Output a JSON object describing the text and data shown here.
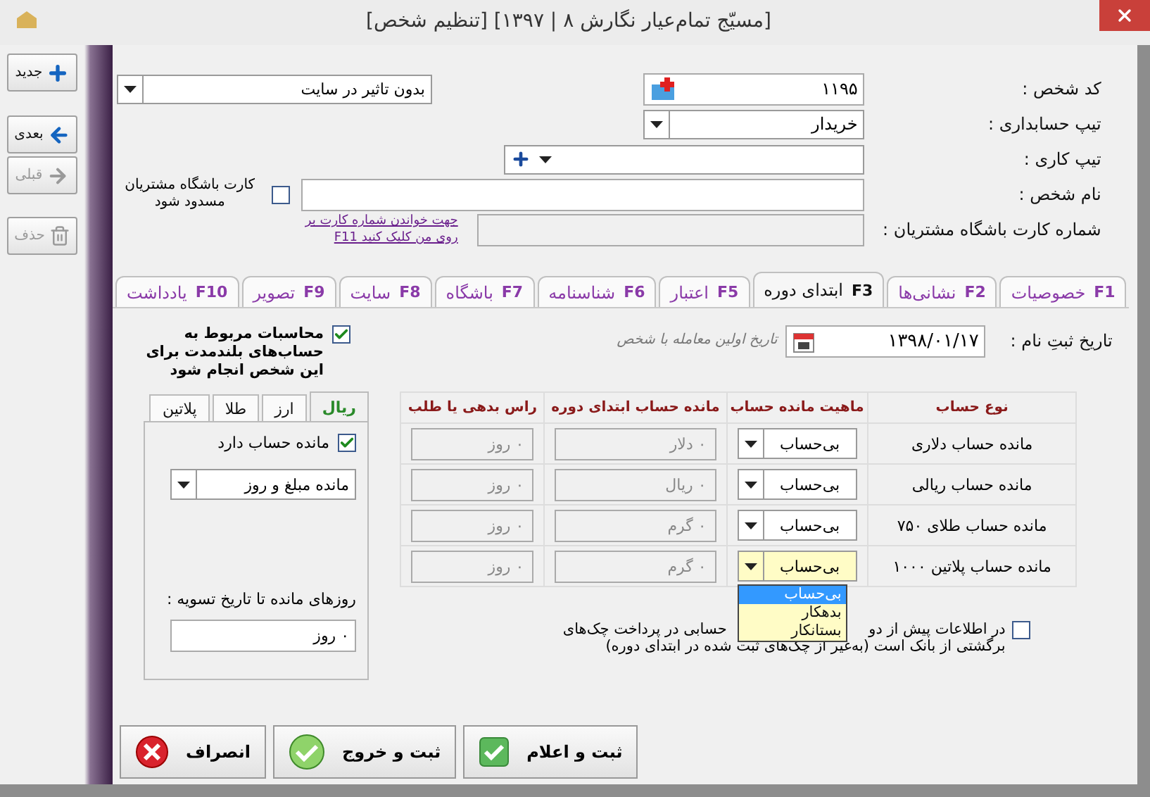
{
  "window": {
    "title": "[مسیّج تمام‌عیار نگارش ۸ | ۱۳۹۷] [تنظیم شخص]"
  },
  "sidebar": {
    "buttons": [
      {
        "label": "جدید",
        "kind": "new",
        "disabled": false
      },
      {
        "label": "بعدی",
        "kind": "next",
        "disabled": false
      },
      {
        "label": "قبلی",
        "kind": "prev",
        "disabled": true
      },
      {
        "label": "حذف",
        "kind": "delete",
        "disabled": true
      }
    ]
  },
  "header": {
    "person_code": {
      "label": "کد شخص :",
      "value": "۱۱۹۵"
    },
    "accounting_type": {
      "label": "تیپ حسابداری :",
      "value": "خریدار"
    },
    "job_type": {
      "label": "تیپ کاری :"
    },
    "person_name": {
      "label": "نام شخص :"
    },
    "club_card": {
      "label": "شماره کارت باشگاه مشتریان :"
    },
    "site_effect": {
      "value": "بدون تاثیر در سایت"
    },
    "block_card": {
      "label": "کارت باشگاه مشتریان مسدود شود",
      "checked": false
    },
    "card_link": "جهت خواندن شماره کارت بر روی من کلیک کنید F11"
  },
  "tabs": [
    {
      "label": "خصوصیات",
      "key": "F1",
      "selected": false
    },
    {
      "label": "نشانی‌ها",
      "key": "F2",
      "selected": false
    },
    {
      "label": "ابتدای دوره",
      "key": "F3",
      "selected": true
    },
    {
      "label": "اعتبار",
      "key": "F5",
      "selected": false
    },
    {
      "label": "شناسنامه",
      "key": "F6",
      "selected": false
    },
    {
      "label": "باشگاه",
      "key": "F7",
      "selected": false
    },
    {
      "label": "سایت",
      "key": "F8",
      "selected": false
    },
    {
      "label": "تصویر",
      "key": "F9",
      "selected": false
    },
    {
      "label": "یادداشت",
      "key": "F10",
      "selected": false
    }
  ],
  "opening": {
    "registration_date": {
      "label": "تاریخ ثبتِ نام :",
      "value": "۱۳۹۸/۰۱/۱۷",
      "hint": "تاریخ اولین معامله با شخص"
    },
    "long_term": {
      "label": "محاسبات مربوط به حساب‌های بلندمدت برای این شخص انجام شود",
      "checked": true
    },
    "currency_tabs": [
      {
        "label": "ریال",
        "selected": true
      },
      {
        "label": "ارز",
        "selected": false
      },
      {
        "label": "طلا",
        "selected": false
      },
      {
        "label": "پلاتین",
        "selected": false
      }
    ],
    "has_balance": {
      "label": "مانده حساب دارد",
      "checked": true
    },
    "balance_mode": "مانده مبلغ و روز",
    "days_label": "روزهای مانده تا تاریخ تسویه :",
    "days_value": "٠ روز",
    "table": {
      "columns": [
        "نوع حساب",
        "ماهیت مانده حساب",
        "مانده حساب ابتدای دوره",
        "راس بدهی یا طلب"
      ],
      "rows": [
        {
          "type": "مانده حساب دلاری",
          "nature": "بی‌حساب",
          "amount": "٠ دلار",
          "due": "٠ روز",
          "focused": false
        },
        {
          "type": "مانده حساب ریالی",
          "nature": "بی‌حساب",
          "amount": "٠ ریال",
          "due": "٠ روز",
          "focused": false
        },
        {
          "type": "مانده حساب طلای ۷۵۰",
          "nature": "بی‌حساب",
          "amount": "٠ گرم",
          "due": "٠ روز",
          "focused": false
        },
        {
          "type": "مانده حساب پلاتین ۱۰۰۰",
          "nature": "بی‌حساب",
          "amount": "٠ گرم",
          "due": "٠ روز",
          "focused": true
        }
      ]
    },
    "open_list": [
      {
        "label": "بی‌حساب",
        "selected": true
      },
      {
        "label": "بدهکار",
        "selected": false
      },
      {
        "label": "بستانکار",
        "selected": false
      }
    ],
    "cheque_note": {
      "checked": false,
      "parts": [
        "در اطلاعات پیش از دو",
        "حسابی در پرداخت چک‌های",
        "برگشتی از بانک است (به‌غیر از چک‌های ثبت شده در ابتدای دوره)"
      ]
    }
  },
  "footer": [
    {
      "label": "ثبت و اعلام",
      "kind": "save_notify"
    },
    {
      "label": "ثبت و خروج",
      "kind": "save_exit"
    },
    {
      "label": "انصراف",
      "kind": "cancel"
    }
  ]
}
